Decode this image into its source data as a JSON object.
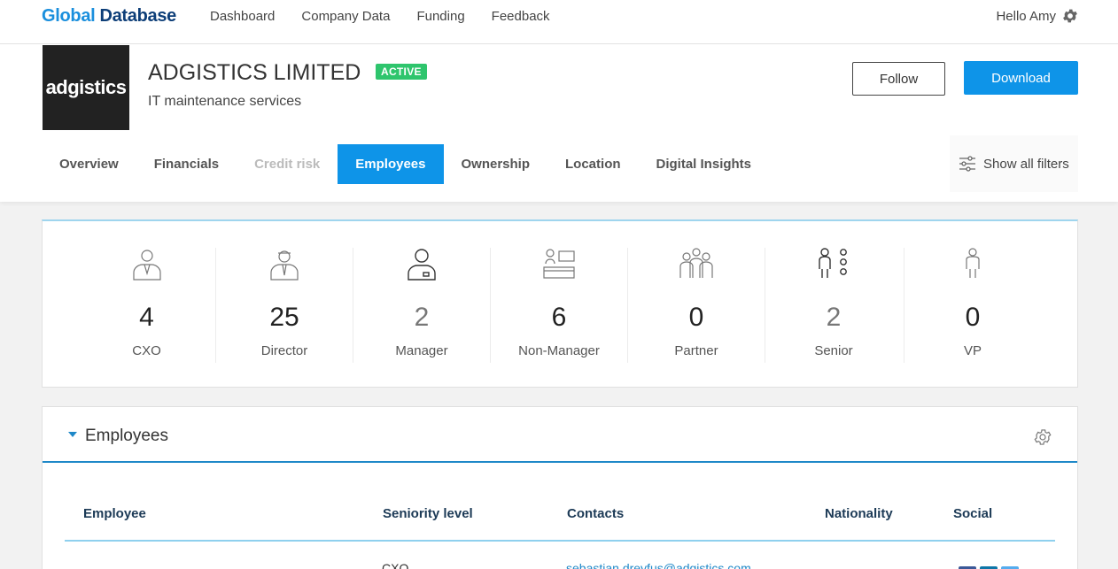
{
  "brand": {
    "part1": "Global",
    "part2": "Database"
  },
  "nav": [
    "Dashboard",
    "Company Data",
    "Funding",
    "Feedback"
  ],
  "user": {
    "greeting": "Hello Amy"
  },
  "company": {
    "logo_text": "adgistics",
    "name": "ADGISTICS LIMITED",
    "status": "ACTIVE",
    "description": "IT maintenance services",
    "follow_label": "Follow",
    "download_label": "Download"
  },
  "tabs": [
    {
      "label": "Overview",
      "state": "normal"
    },
    {
      "label": "Financials",
      "state": "normal"
    },
    {
      "label": "Credit risk",
      "state": "disabled"
    },
    {
      "label": "Employees",
      "state": "active"
    },
    {
      "label": "Ownership",
      "state": "normal"
    },
    {
      "label": "Location",
      "state": "normal"
    },
    {
      "label": "Digital Insights",
      "state": "normal"
    }
  ],
  "filters_label": "Show all filters",
  "stats": [
    {
      "value": "4",
      "label": "CXO",
      "icon": "executive-icon"
    },
    {
      "value": "25",
      "label": "Director",
      "icon": "director-icon"
    },
    {
      "value": "2",
      "label": "Manager",
      "icon": "manager-icon"
    },
    {
      "value": "6",
      "label": "Non-Manager",
      "icon": "desk-worker-icon"
    },
    {
      "value": "0",
      "label": "Partner",
      "icon": "group-icon"
    },
    {
      "value": "2",
      "label": "Senior",
      "icon": "senior-levels-icon"
    },
    {
      "value": "0",
      "label": "VP",
      "icon": "person-icon"
    }
  ],
  "employees": {
    "title": "Employees",
    "columns": [
      "Employee",
      "Seniority level",
      "Contacts",
      "Nationality",
      "Social"
    ],
    "first_row": {
      "seniority": "CXO",
      "email": "sebastian.dreyfus@adgistics.com"
    }
  },
  "colors": {
    "accent": "#0e94e8",
    "active_badge": "#2ec56d",
    "brand_dark": "#0d3e78"
  }
}
